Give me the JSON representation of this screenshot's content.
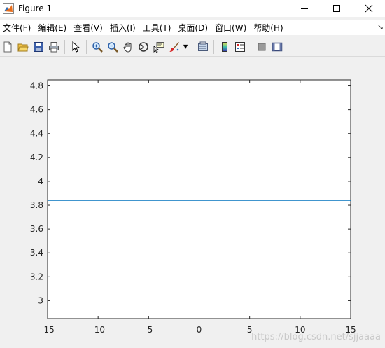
{
  "window": {
    "title": "Figure 1",
    "controls": [
      "minimize-icon",
      "maximize-icon",
      "close-icon"
    ]
  },
  "menu": {
    "items": [
      "文件(F)",
      "编辑(E)",
      "查看(V)",
      "插入(I)",
      "工具(T)",
      "桌面(D)",
      "窗口(W)",
      "帮助(H)"
    ]
  },
  "toolbar": {
    "buttons": [
      "new-figure-icon",
      "open-icon",
      "save-icon",
      "print-icon",
      "pointer-icon",
      "zoom-in-icon",
      "zoom-out-icon",
      "pan-icon",
      "rotate-3d-icon",
      "data-cursor-icon",
      "brush-icon",
      "link-plot-icon",
      "colorbar-icon",
      "legend-icon",
      "hide-plot-tools-icon",
      "show-plot-tools-icon"
    ]
  },
  "watermark": "https://blog.csdn.net/sjjaaaa",
  "chart_data": {
    "type": "line",
    "xlim": [
      -15,
      15
    ],
    "ylim": [
      2.85,
      4.85
    ],
    "xticks": [
      -15,
      -10,
      -5,
      0,
      5,
      10,
      15
    ],
    "yticks": [
      3,
      3.2,
      3.4,
      3.6,
      3.8,
      4,
      4.2,
      4.4,
      4.6,
      4.8
    ],
    "series": [
      {
        "x": [
          -15,
          15
        ],
        "y": [
          3.84,
          3.84
        ],
        "color": "#0072bd"
      }
    ],
    "grid": false
  }
}
